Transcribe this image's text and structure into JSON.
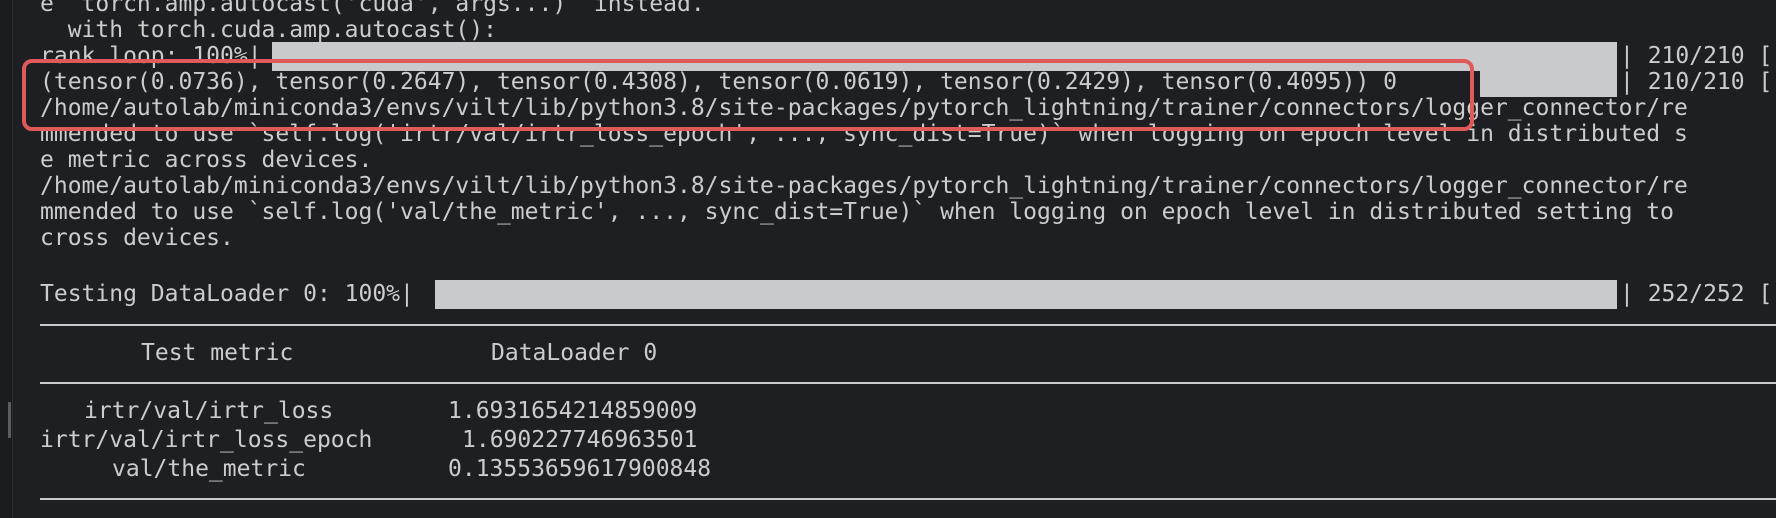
{
  "terminal": {
    "lines": {
      "l0": "e  torch.amp.autocast('cuda', args...)` instead.",
      "l1": "  with torch.cuda.amp.autocast():",
      "rank_prefix": "rank loop: 100%|",
      "rank_suffix": "| 210/210 [",
      "tensor_line": "(tensor(0.0736), tensor(0.2647), tensor(0.4308), tensor(0.0619), tensor(0.2429), tensor(0.4095)) 0",
      "tensor_suffix": "| 210/210 [",
      "l4": "/home/autolab/miniconda3/envs/vilt/lib/python3.8/site-packages/pytorch_lightning/trainer/connectors/logger_connector/re",
      "l5": "mmended to use `self.log('irtr/val/irtr_loss_epoch', ..., sync_dist=True)` when logging on epoch level in distributed s",
      "l6": "e metric across devices.",
      "l7": "/home/autolab/miniconda3/envs/vilt/lib/python3.8/site-packages/pytorch_lightning/trainer/connectors/logger_connector/re",
      "l8": "mmended to use `self.log('val/the_metric', ..., sync_dist=True)` when logging on epoch level in distributed setting to",
      "l9": "cross devices.",
      "test_prefix": "Testing DataLoader 0: 100%|",
      "test_suffix": "| 252/252 ["
    },
    "progress": {
      "rank_loop": 1.0,
      "tensor_line": 1.0,
      "testing_dataloader": 1.0
    },
    "results_table": {
      "headers": [
        "Test metric",
        "DataLoader 0"
      ],
      "rows": [
        {
          "metric": "irtr/val/irtr_loss",
          "value": "1.6931654214859009"
        },
        {
          "metric": "irtr/val/irtr_loss_epoch",
          "value": "1.690227746963501"
        },
        {
          "metric": "val/the_metric",
          "value": "0.13553659617900848"
        }
      ]
    },
    "colors": {
      "background": "#1e1f22",
      "text": "#cccccc",
      "progress_fill": "#c9cacc",
      "annotation": "#e05a5a"
    }
  }
}
